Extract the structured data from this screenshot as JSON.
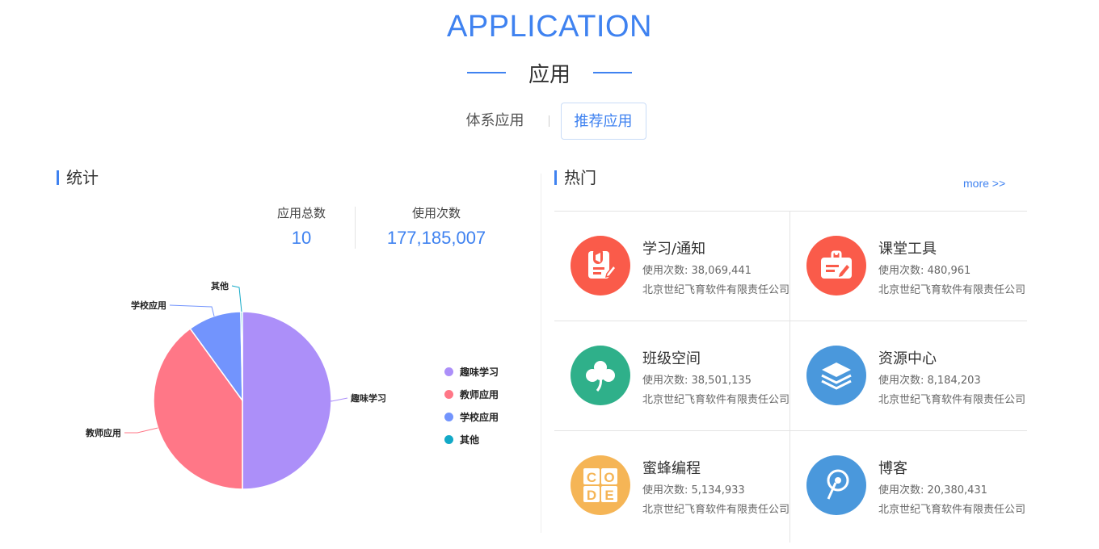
{
  "header": {
    "title": "APPLICATION",
    "subtitle": "应用"
  },
  "tabs": [
    {
      "label": "体系应用"
    },
    {
      "label": "推荐应用",
      "active": true
    }
  ],
  "stats": {
    "section_title": "统计",
    "total_label": "应用总数",
    "total_value": "10",
    "usage_label": "使用次数",
    "usage_value": "177,185,007"
  },
  "chart_data": {
    "type": "pie",
    "categories": [
      "趣味学习",
      "教师应用",
      "学校应用",
      "其他"
    ],
    "values": [
      50,
      40,
      9.7,
      0.3
    ],
    "colors": [
      "#ac8ff9",
      "#ff7787",
      "#7294fd",
      "#12a9c7"
    ],
    "legend_position": "right"
  },
  "hot": {
    "section_title": "热门",
    "more_label": "more >>",
    "items": [
      {
        "name": "学习/通知",
        "count": "使用次数: 38,069,441",
        "company": "北京世纪飞育软件有限责任公司",
        "icon": "notice-icon",
        "color": "#fa5b4a"
      },
      {
        "name": "课堂工具",
        "count": "使用次数: 480,961",
        "company": "北京世纪飞育软件有限责任公司",
        "icon": "clipboard-icon",
        "color": "#fa5b4a"
      },
      {
        "name": "班级空间",
        "count": "使用次数: 38,501,135",
        "company": "北京世纪飞育软件有限责任公司",
        "icon": "clover-icon",
        "color": "#2fb08a"
      },
      {
        "name": "资源中心",
        "count": "使用次数: 8,184,203",
        "company": "北京世纪飞育软件有限责任公司",
        "icon": "layers-icon",
        "color": "#4a98dc"
      },
      {
        "name": "蜜蜂编程",
        "count": "使用次数: 5,134,933",
        "company": "北京世纪飞育软件有限责任公司",
        "icon": "code-icon",
        "color": "#f5b556"
      },
      {
        "name": "博客",
        "count": "使用次数: 20,380,431",
        "company": "北京世纪飞育软件有限责任公司",
        "icon": "blog-icon",
        "color": "#4a98dc"
      }
    ]
  }
}
